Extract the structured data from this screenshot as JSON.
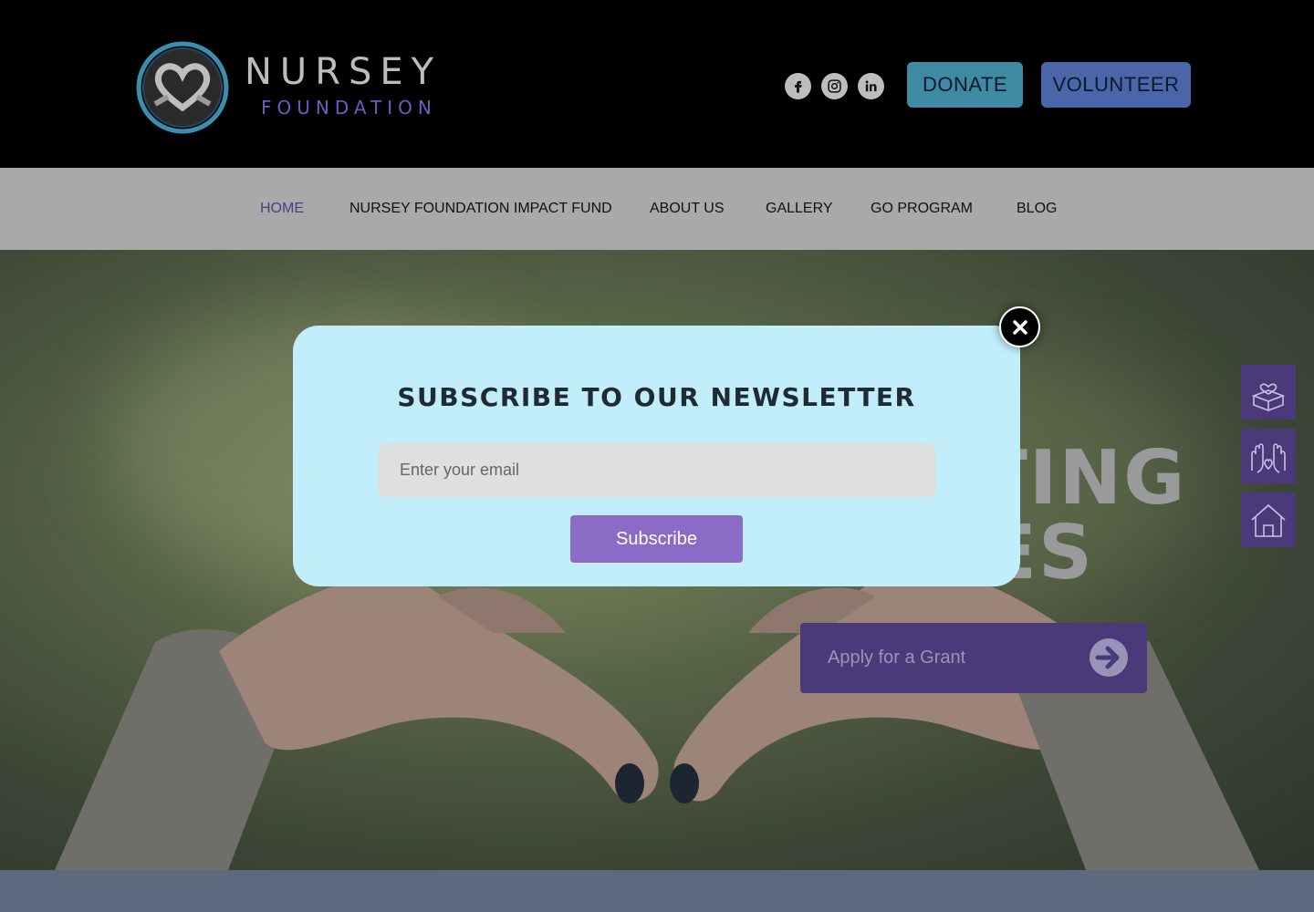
{
  "brand": {
    "name": "NURSEY",
    "subtitle": "FOUNDATION"
  },
  "header": {
    "donate_label": "DONATE",
    "volunteer_label": "VOLUNTEER",
    "social": [
      "facebook-icon",
      "instagram-icon",
      "linkedin-icon"
    ]
  },
  "nav": {
    "items": [
      {
        "label": "HOME",
        "active": true
      },
      {
        "label": "NURSEY FOUNDATION IMPACT FUND",
        "active": false
      },
      {
        "label": "ABOUT US",
        "active": false
      },
      {
        "label": "GALLERY",
        "active": false
      },
      {
        "label": "GO PROGRAM",
        "active": false
      },
      {
        "label": "BLOG",
        "active": false
      }
    ]
  },
  "hero": {
    "title_line1": "TING",
    "title_line2": "ES",
    "grant_label": "Apply for a Grant"
  },
  "sidebar": {
    "items": [
      "donate-box-icon",
      "helping-hands-icon",
      "home-icon"
    ]
  },
  "modal": {
    "title": "SUBSCRIBE TO OUR NEWSLETTER",
    "email_placeholder": "Enter your email",
    "subscribe_label": "Subscribe"
  },
  "colors": {
    "accent": "#8a6cc6",
    "modal_bg": "#c2eefc",
    "donate": "#3f8aa3",
    "volunteer": "#4a66a8",
    "nav_active": "#4a3f86"
  }
}
